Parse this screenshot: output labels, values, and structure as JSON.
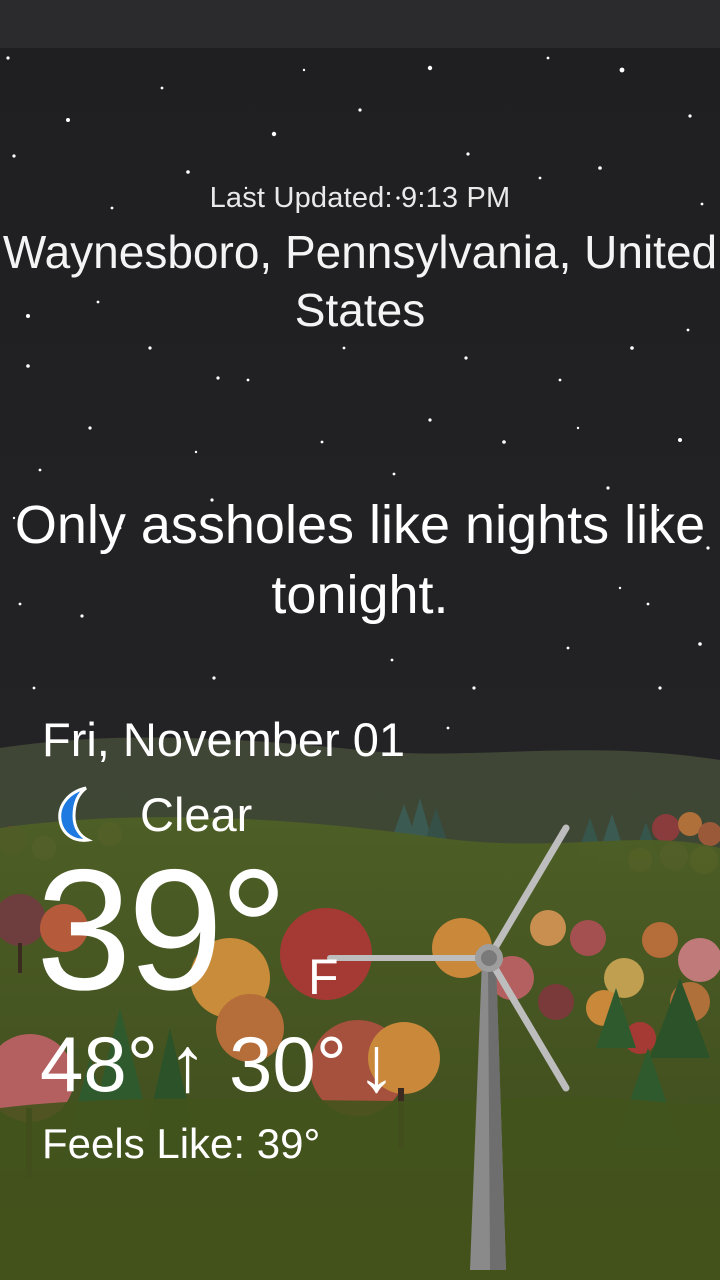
{
  "header": {
    "last_updated": "Last Updated: 9:13 PM",
    "location": "Waynesboro, Pennsylvania, United States"
  },
  "quote": "Only assholes like nights like tonight.",
  "forecast": {
    "date": "Fri, November 01",
    "condition": "Clear",
    "condition_icon": "moon-icon",
    "temperature": "39°",
    "unit": "F",
    "high": "48°",
    "high_arrow": "↑",
    "low": "30°",
    "low_arrow": "↓",
    "feels_like": "Feels Like: 39°"
  },
  "colors": {
    "sky": "#222224",
    "hills": "#4a5a2e",
    "moon": "#1e7ae0",
    "text": "#ffffff"
  }
}
